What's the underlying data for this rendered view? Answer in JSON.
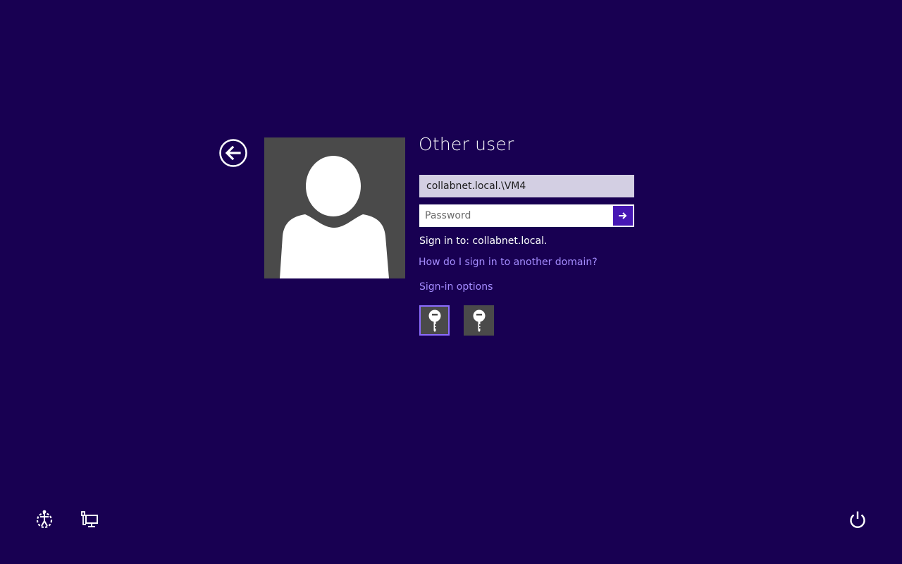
{
  "login": {
    "title": "Other user",
    "username_value": "collabnet.local.\\VM4",
    "password_placeholder": "Password",
    "sign_in_to": "Sign in to: collabnet.local.",
    "domain_help_link": "How do I sign in to another domain?",
    "sign_in_options_link": "Sign-in options"
  },
  "sign_in_options": [
    {
      "icon": "key-icon",
      "selected": true
    },
    {
      "icon": "key-icon",
      "selected": false
    }
  ],
  "bottom_bar": {
    "left_icons": [
      "ease-of-access-icon",
      "network-icon"
    ],
    "right_icons": [
      "power-icon"
    ]
  },
  "colors": {
    "background": "#180052",
    "avatar_background": "#4a4a4a",
    "username_field": "#d3cfe3",
    "submit_button": "#4617b4",
    "link": "#a58cff",
    "selected_border": "#8c6cff"
  }
}
